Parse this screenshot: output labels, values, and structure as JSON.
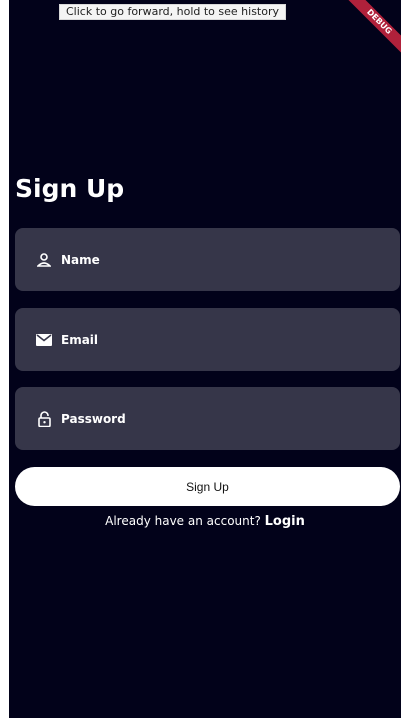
{
  "tooltip": "Click to go forward, hold to see history",
  "debug_banner": "DEBUG",
  "title": "Sign Up",
  "fields": {
    "name": {
      "label": "Name",
      "icon": "person-icon"
    },
    "email": {
      "label": "Email",
      "icon": "mail-icon"
    },
    "password": {
      "label": "Password",
      "icon": "lock-icon"
    }
  },
  "signup_button": "Sign Up",
  "footer": {
    "prompt": "Already have an account? ",
    "login": "Login"
  },
  "colors": {
    "background": "#02021a",
    "field": "#363649",
    "button": "#ffffff",
    "debug": "#b0213b"
  }
}
